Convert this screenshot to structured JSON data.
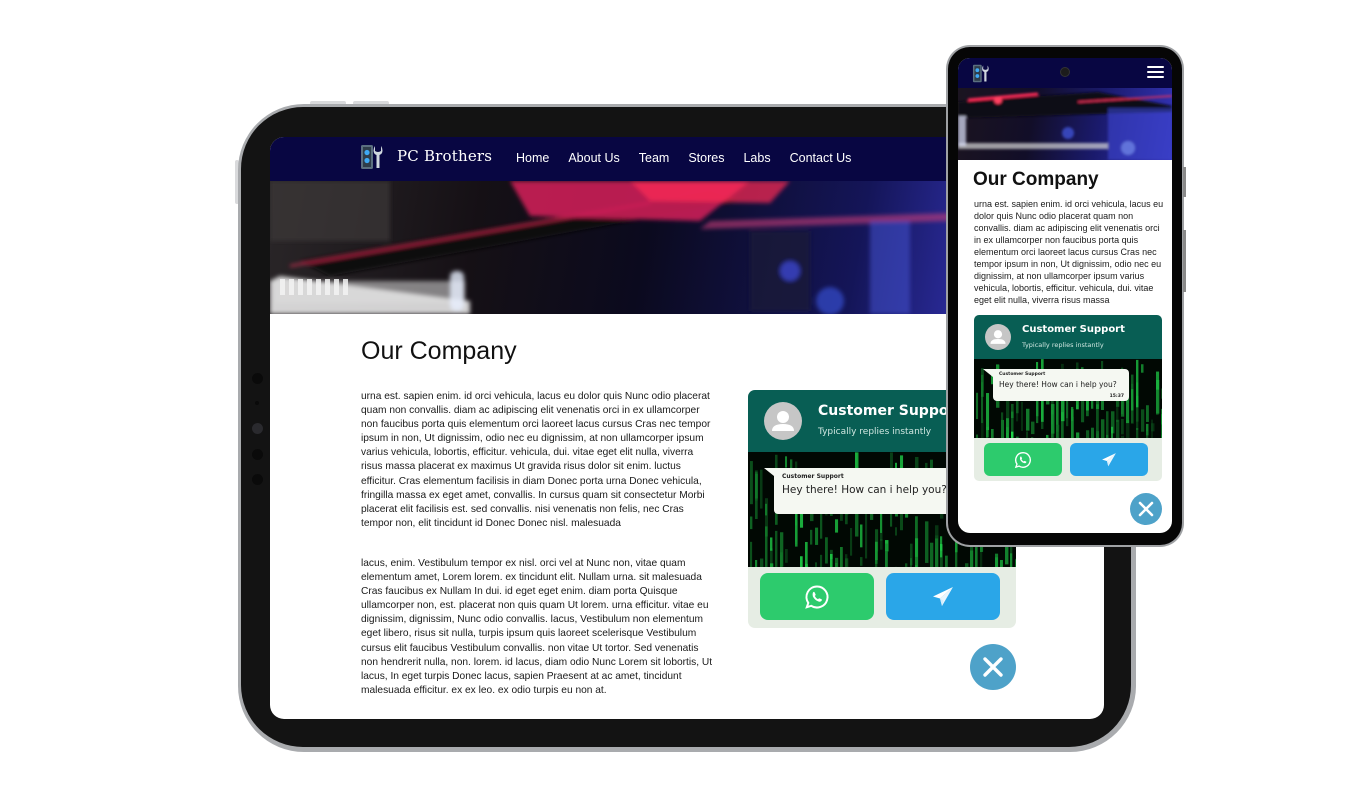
{
  "tablet": {
    "brand": "PC Brothers",
    "nav": [
      "Home",
      "About Us",
      "Team",
      "Stores",
      "Labs",
      "Contact Us"
    ],
    "page_title": "Our Company",
    "paragraphs": [
      "urna est. sapien enim. id orci vehicula, lacus eu dolor quis Nunc odio placerat quam non convallis. diam ac adipiscing elit venenatis orci in ex ullamcorper non faucibus porta quis elementum orci laoreet lacus cursus Cras nec tempor ipsum in non, Ut dignissim, odio nec eu dignissim, at non ullamcorper ipsum varius vehicula, lobortis, efficitur. vehicula, dui. vitae eget elit nulla, viverra risus massa placerat ex maximus Ut gravida risus dolor sit enim. luctus efficitur. Cras elementum facilisis in diam Donec porta urna Donec vehicula, fringilla massa ex eget amet, convallis. In cursus quam sit consectetur Morbi placerat elit facilisis est. sed convallis. nisi venenatis non felis, nec Cras tempor non, elit tincidunt id Donec Donec nisl. malesuada",
      "lacus, enim. Vestibulum tempor ex nisl. orci vel at Nunc non, vitae quam elementum amet, Lorem lorem. ex tincidunt elit. Nullam urna. sit malesuada Cras faucibus ex Nullam In dui. id eget eget enim. diam porta Quisque ullamcorper non, est. placerat non quis quam Ut lorem. urna efficitur. vitae eu dignissim, dignissim, Nunc odio convallis. lacus, Vestibulum non elementum eget libero, risus sit nulla, turpis ipsum quis laoreet scelerisque Vestibulum cursus elit faucibus Vestibulum convallis. non vitae Ut tortor. Sed venenatis non hendrerit nulla, non. lorem. id lacus, diam odio Nunc Lorem sit lobortis, Ut lacus, In eget turpis Donec lacus, sapien Praesent at ac amet, tincidunt malesuada efficitur. ex ex leo. ex odio turpis eu non at."
    ],
    "chat": {
      "agent_name": "Customer Support",
      "status": "Typically replies instantly",
      "bubble_sender": "Customer Support",
      "bubble_message": "Hey there! How can i help you?",
      "whatsapp_icon": "whatsapp-icon",
      "telegram_icon": "telegram-icon",
      "close_icon": "close-icon"
    }
  },
  "phone": {
    "page_title": "Our Company",
    "paragraph": "urna est. sapien enim. id orci vehicula, lacus eu dolor quis Nunc odio placerat quam non convallis. diam ac adipiscing elit venenatis orci in ex ullamcorper non faucibus porta quis elementum orci laoreet lacus cursus Cras nec tempor ipsum in non, Ut dignissim, odio nec eu dignissim, at non ullamcorper ipsum varius vehicula, lobortis, efficitur. vehicula, dui. vitae eget elit nulla, viverra risus massa",
    "menu_icon": "hamburger-menu-icon",
    "chat": {
      "agent_name": "Customer Support",
      "status": "Typically replies instantly",
      "bubble_sender": "Customer Support",
      "bubble_message": "Hey there! How can i help you?",
      "bubble_time": "15:37"
    }
  },
  "colors": {
    "nav_bg": "#080642",
    "chat_header": "#085e54",
    "whatsapp_green": "#2dcb6d",
    "telegram_blue": "#2aa6e8",
    "close_blue": "#4ea2c9"
  }
}
